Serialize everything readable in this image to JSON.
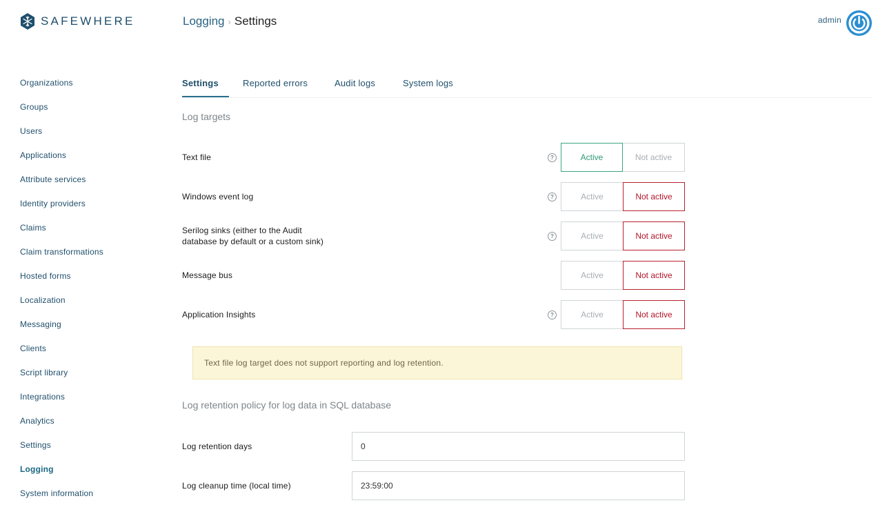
{
  "brand": {
    "name": "SAFEWHERE",
    "accent": "#1e4e6b"
  },
  "breadcrumb": {
    "parent": "Logging",
    "separator": "›",
    "current": "Settings"
  },
  "user": {
    "name": "admin",
    "avatar_icon": "power-icon",
    "avatar_color": "#2b8ed1"
  },
  "sidebar": {
    "items": [
      {
        "label": "Organizations",
        "active": false
      },
      {
        "label": "Groups",
        "active": false
      },
      {
        "label": "Users",
        "active": false
      },
      {
        "label": "Applications",
        "active": false
      },
      {
        "label": "Attribute services",
        "active": false
      },
      {
        "label": "Identity providers",
        "active": false
      },
      {
        "label": "Claims",
        "active": false
      },
      {
        "label": "Claim transformations",
        "active": false
      },
      {
        "label": "Hosted forms",
        "active": false
      },
      {
        "label": "Localization",
        "active": false
      },
      {
        "label": "Messaging",
        "active": false
      },
      {
        "label": "Clients",
        "active": false
      },
      {
        "label": "Script library",
        "active": false
      },
      {
        "label": "Integrations",
        "active": false
      },
      {
        "label": "Analytics",
        "active": false
      },
      {
        "label": "Settings",
        "active": false
      },
      {
        "label": "Logging",
        "active": true
      },
      {
        "label": "System information",
        "active": false
      }
    ]
  },
  "tabs": [
    {
      "label": "Settings",
      "active": true
    },
    {
      "label": "Reported errors",
      "active": false
    },
    {
      "label": "Audit logs",
      "active": false
    },
    {
      "label": "System logs",
      "active": false
    }
  ],
  "log_targets": {
    "title": "Log targets",
    "help_glyph": "?",
    "active_label": "Active",
    "inactive_label": "Not active",
    "rows": [
      {
        "label": "Text file",
        "state": "active",
        "help": true
      },
      {
        "label": "Windows event log",
        "state": "not_active",
        "help": true
      },
      {
        "label_line1": "Serilog sinks (either to the Audit",
        "label_line2": "database by default or a custom sink)",
        "state": "not_active",
        "help": true
      },
      {
        "label": "Message bus",
        "state": "not_active",
        "help": false
      },
      {
        "label": "Application Insights",
        "state": "not_active",
        "help": true
      }
    ]
  },
  "notice": {
    "text": "Text file log target does not support reporting and log retention."
  },
  "retention": {
    "title": "Log retention policy for log data in SQL database",
    "days_label": "Log retention days",
    "days_value": "0",
    "cleanup_label": "Log cleanup time (local time)",
    "cleanup_value": "23:59:00"
  }
}
